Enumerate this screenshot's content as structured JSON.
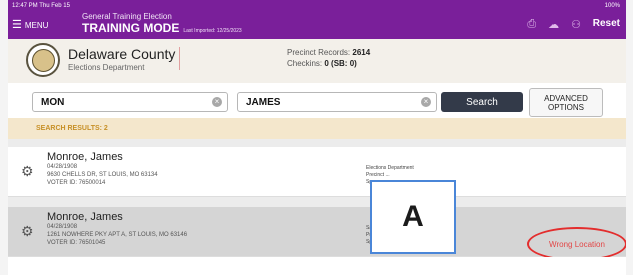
{
  "status_bar": {
    "time": "12:47 PM  Thu Feb 15",
    "battery": "100%"
  },
  "header": {
    "menu_label": "MENU",
    "election_title": "General Training Election",
    "mode": "TRAINING MODE",
    "last_imported": "Last Imported: 12/25/2023",
    "reset_label": "Reset"
  },
  "county": {
    "name": "Delaware County",
    "department": "Elections Department",
    "precinct_records_label": "Precinct Records:",
    "precinct_records_value": "2614",
    "checkins_label": "Checkins:",
    "checkins_value": "0 (SB: 0)"
  },
  "search": {
    "last_name_value": "MON",
    "first_name_value": "JAMES",
    "search_label": "Search",
    "advanced_line1": "ADVANCED",
    "advanced_line2": "OPTIONS"
  },
  "results": {
    "label": "SEARCH RESULTS: 2",
    "rows": [
      {
        "name": "Monroe, James",
        "dob": "04/28/1908",
        "address": "9630 CHELLS DR, ST LOUIS, MO 63134",
        "voter_id": "VOTER ID: 76500014",
        "side_line1": "Elections Department",
        "side_line2": "Precinct ...",
        "side_line3": "Sp..."
      },
      {
        "name": "Monroe, James",
        "dob": "04/28/1908",
        "address": "1261 NOWHERE PKY APT A, ST LOUIS, MO 63146",
        "voter_id": "VOTER ID: 76501045",
        "side_line1": "Sa...",
        "side_line2": "Pr...",
        "side_line3": "Sp...",
        "warning": "Wrong Location"
      }
    ]
  },
  "annotation": {
    "label": "A"
  }
}
